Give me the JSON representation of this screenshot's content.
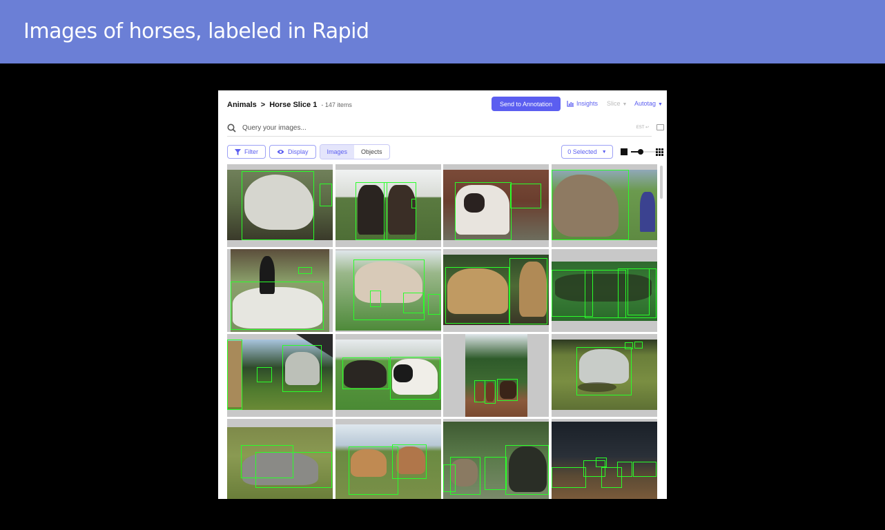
{
  "banner": {
    "title": "Images of horses, labeled in Rapid"
  },
  "header": {
    "breadcrumb_root": "Animals",
    "breadcrumb_separator": ">",
    "breadcrumb_current": "Horse Slice 1",
    "item_count": "- 147 items",
    "send_button": "Send to Annotation",
    "insights": "Insights",
    "slice": "Slice",
    "autotag": "Autotag"
  },
  "search": {
    "placeholder": "Query your images...",
    "hint": "EST ↩"
  },
  "toolbar": {
    "filter": "Filter",
    "display": "Display",
    "tab_images": "Images",
    "tab_objects": "Objects",
    "selected": "0 Selected"
  },
  "colors": {
    "accent": "#5b5ef0",
    "banner": "#6b7fd6",
    "bbox": "#2aff2a"
  },
  "icons": [
    "search-icon",
    "filter-icon",
    "eye-icon",
    "chart-icon",
    "stack-icon",
    "square-icon",
    "grid-icon"
  ]
}
